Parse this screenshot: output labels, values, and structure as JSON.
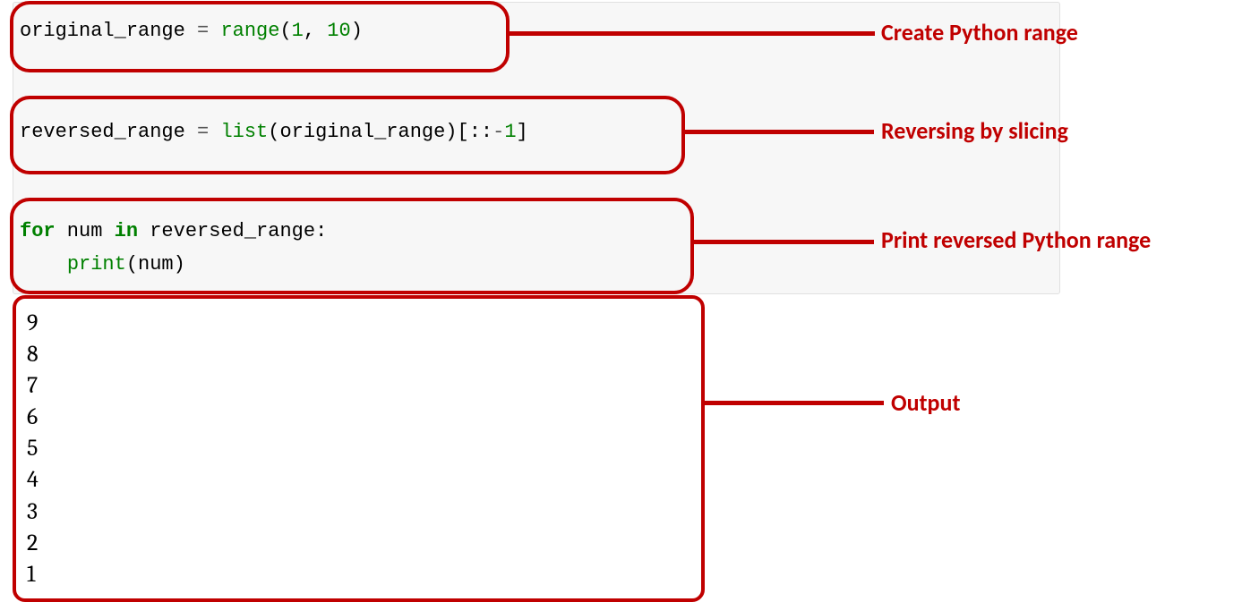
{
  "code": {
    "line1": {
      "t1": "original_range ",
      "t2": "=",
      "t3": " ",
      "t4": "range",
      "t5": "(",
      "t6": "1",
      "t7": ", ",
      "t8": "10",
      "t9": ")"
    },
    "line2": {
      "t1": "reversed_range ",
      "t2": "=",
      "t3": " ",
      "t4": "list",
      "t5": "(original_range)[::",
      "t6": "-",
      "t7": "1",
      "t8": "]"
    },
    "line3": {
      "t1": "for",
      "t2": " num ",
      "t3": "in",
      "t4": " reversed_range:"
    },
    "line4": {
      "t1": "    ",
      "t2": "print",
      "t3": "(num)"
    }
  },
  "annotations": {
    "a1": "Create Python range",
    "a2": "Reversing by slicing",
    "a3": "Print reversed Python range",
    "a4": "Output"
  },
  "output_lines": [
    "9",
    "8",
    "7",
    "6",
    "5",
    "4",
    "3",
    "2",
    "1"
  ]
}
